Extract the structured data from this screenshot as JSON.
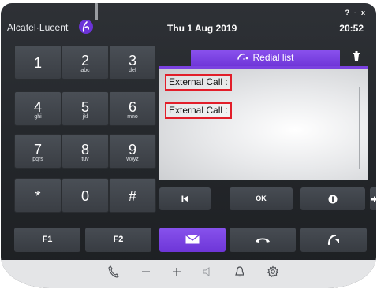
{
  "header": {
    "brand": "Alcatel·Lucent",
    "date": "Thu 1 Aug 2019",
    "time": "20:52",
    "window_controls": [
      "?",
      "-",
      "x"
    ]
  },
  "keypad": [
    {
      "digit": "1",
      "letters": ""
    },
    {
      "digit": "2",
      "letters": "abc"
    },
    {
      "digit": "3",
      "letters": "def"
    },
    {
      "digit": "4",
      "letters": "ghi"
    },
    {
      "digit": "5",
      "letters": "jkl"
    },
    {
      "digit": "6",
      "letters": "mno"
    },
    {
      "digit": "7",
      "letters": "pqrs"
    },
    {
      "digit": "8",
      "letters": "tuv"
    },
    {
      "digit": "9",
      "letters": "wxyz"
    },
    {
      "digit": "*",
      "letters": ""
    },
    {
      "digit": "0",
      "letters": ""
    },
    {
      "digit": "#",
      "letters": ""
    }
  ],
  "redial": {
    "tab_label": "Redial list",
    "entries": [
      "External Call :",
      "External Call :"
    ]
  },
  "actions": {
    "ok_label": "OK"
  },
  "function_keys": {
    "f1": "F1",
    "f2": "F2"
  },
  "icons": {
    "brand_logo": "alcatel-logo-icon",
    "redial_tab": "redial-icon",
    "trash": "trash-icon",
    "previous": "skip-previous-icon",
    "info": "info-icon",
    "more": "arrow-right-icon",
    "mail": "envelope-icon",
    "hangup": "hang-up-icon",
    "transfer": "call-transfer-icon",
    "footer": [
      "handset-icon",
      "volume-down-icon",
      "volume-up-icon",
      "speaker-muted-icon",
      "bell-icon",
      "gear-icon"
    ]
  },
  "colors": {
    "accent_purple": "#7a41e0",
    "highlight_red": "#e21e2a",
    "body_dark": "#2b2e33"
  }
}
